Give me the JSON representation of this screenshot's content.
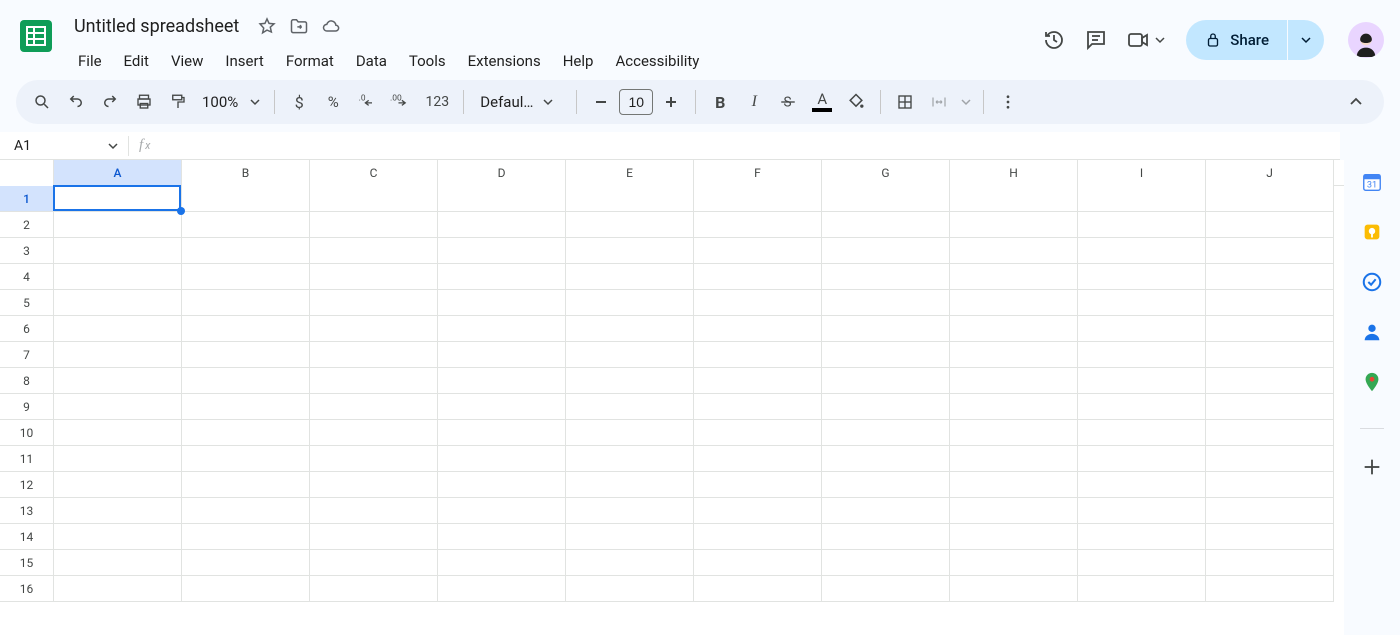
{
  "doc": {
    "title": "Untitled spreadsheet"
  },
  "menus": [
    "File",
    "Edit",
    "View",
    "Insert",
    "Format",
    "Data",
    "Tools",
    "Extensions",
    "Help",
    "Accessibility"
  ],
  "share": {
    "label": "Share"
  },
  "toolbar": {
    "zoom": "100%",
    "font_name": "Defaul…",
    "font_size": "10",
    "number_format_123": "123"
  },
  "namebox": {
    "value": "A1"
  },
  "formula": {
    "value": ""
  },
  "columns": [
    "A",
    "B",
    "C",
    "D",
    "E",
    "F",
    "G",
    "H",
    "I",
    "J"
  ],
  "rows": [
    "1",
    "2",
    "3",
    "4",
    "5",
    "6",
    "7",
    "8",
    "9",
    "10",
    "11",
    "12",
    "13",
    "14",
    "15",
    "16"
  ],
  "selection": {
    "col_index": 0,
    "row_index": 0
  },
  "sidepanel_calendar_day": "31"
}
